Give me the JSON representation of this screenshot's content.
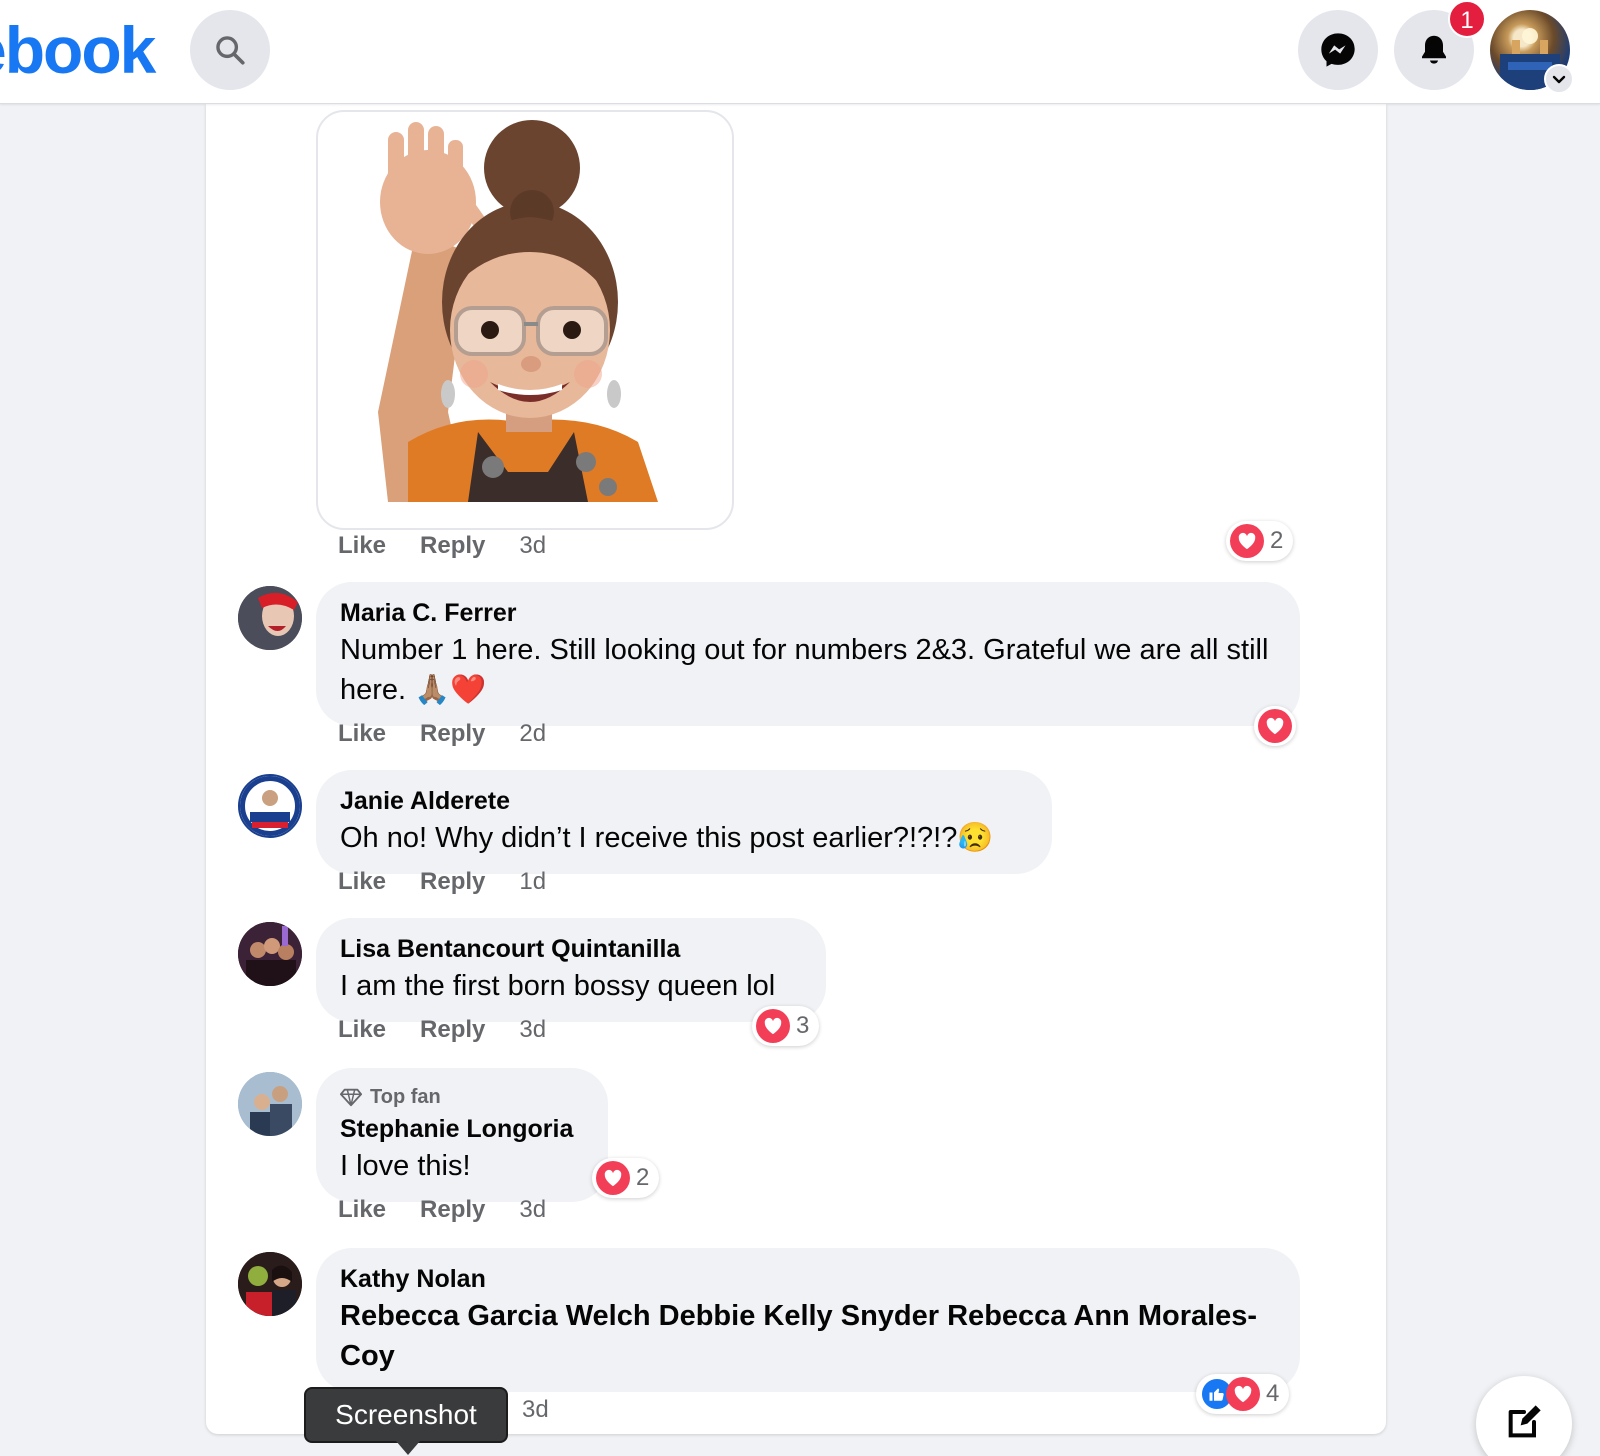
{
  "topbar": {
    "logo_text": "ebook",
    "notification_count": "1",
    "icons": [
      "search-icon",
      "messenger-icon",
      "bell-icon",
      "chevron-down-icon"
    ]
  },
  "first_comment": {
    "like_label": "Like",
    "reply_label": "Reply",
    "time": "3d",
    "reaction_count": "2"
  },
  "comments": [
    {
      "author": "Maria C. Ferrer",
      "text": "Number 1 here. Still looking out for numbers 2&3. Grateful we are all still here. 🙏🏽❤️",
      "like_label": "Like",
      "reply_label": "Reply",
      "time": "2d",
      "reaction_count": ""
    },
    {
      "author": "Janie Alderete",
      "text": "Oh no! Why didn’t I receive this post earlier?!?!?😥",
      "like_label": "Like",
      "reply_label": "Reply",
      "time": "1d"
    },
    {
      "author": "Lisa Bentancourt Quintanilla",
      "text": "I am the first born bossy queen lol",
      "like_label": "Like",
      "reply_label": "Reply",
      "time": "3d",
      "reaction_count": "3"
    },
    {
      "badge": "Top fan",
      "author": "Stephanie Longoria",
      "text": "I love this!",
      "like_label": "Like",
      "reply_label": "Reply",
      "time": "3d",
      "reaction_count": "2"
    },
    {
      "author": "Kathy Nolan",
      "text": "Rebecca Garcia Welch Debbie Kelly Snyder Rebecca Ann Morales-Coy",
      "time": "3d",
      "reaction_count": "4"
    }
  ],
  "tooltip": {
    "label": "Screenshot"
  },
  "colors": {
    "brand": "#1877f2",
    "heart": "#f33e58",
    "badge": "#e41e3f"
  }
}
